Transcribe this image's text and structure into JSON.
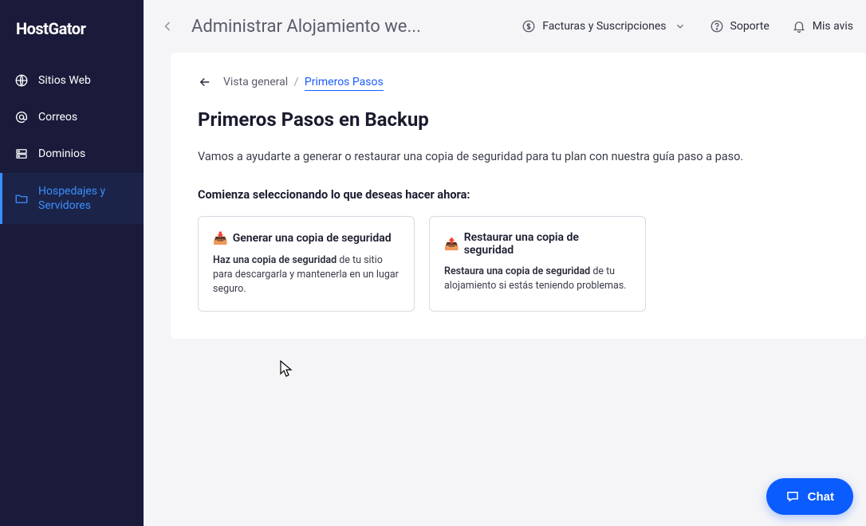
{
  "brand": "HostGator",
  "sidebar": {
    "items": [
      {
        "label": "Sitios Web"
      },
      {
        "label": "Correos"
      },
      {
        "label": "Dominios"
      },
      {
        "label": "Hospedajes y Servidores"
      }
    ]
  },
  "topbar": {
    "title": "Administrar Alojamiento we...",
    "actions": {
      "billing": "Facturas y Suscripciones",
      "support": "Soporte",
      "notifications": "Mis avis"
    }
  },
  "breadcrumb": {
    "parent": "Vista general",
    "current": "Primeros Pasos"
  },
  "page": {
    "title": "Primeros Pasos en Backup",
    "description": "Vamos a ayudarte a generar o restaurar una copia de seguridad para tu plan con nuestra guía paso a paso.",
    "section_label": "Comienza seleccionando lo que deseas hacer ahora:"
  },
  "cards": [
    {
      "emoji": "📥",
      "title": "Generar una copia de seguridad",
      "desc_lead": "Haz una copia de seguridad",
      "desc_rest": " de tu sitio para descargarla y mantenerla en un lugar seguro."
    },
    {
      "emoji": "📤",
      "title": "Restaurar una copia de seguridad",
      "desc_lead": "Restaura una copia de seguridad",
      "desc_rest": " de tu alojamiento si estás teniendo problemas."
    }
  ],
  "chat": {
    "label": "Chat"
  }
}
